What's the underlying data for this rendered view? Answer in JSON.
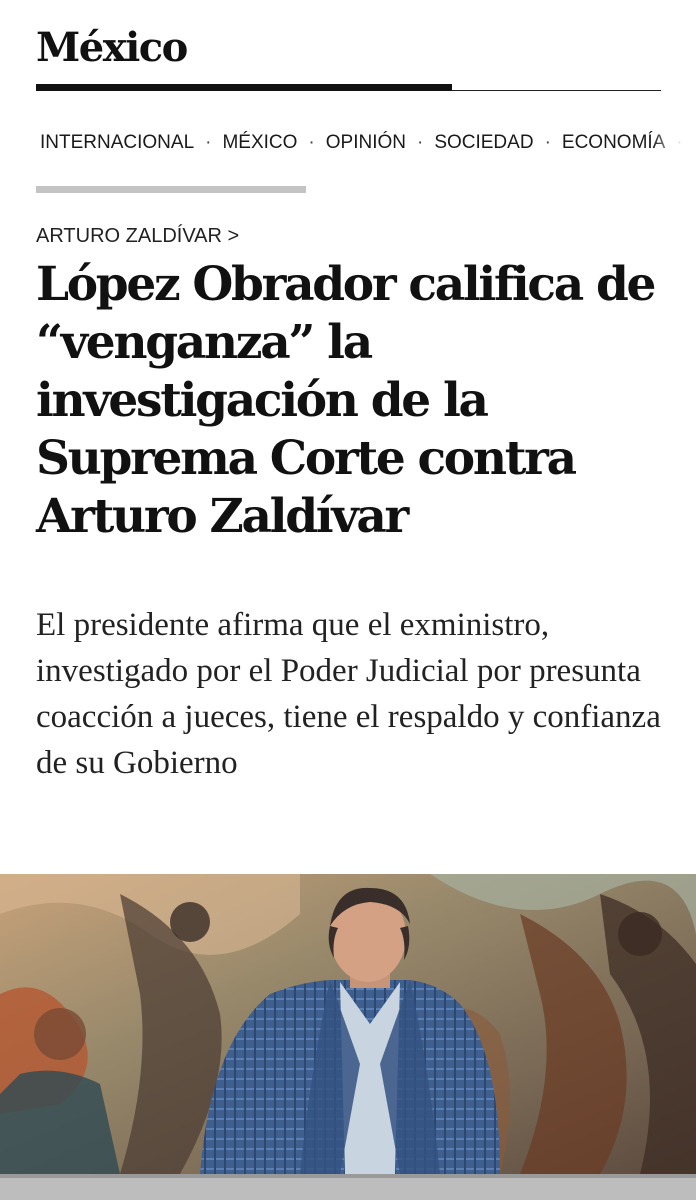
{
  "section": {
    "title": "México"
  },
  "nav": {
    "items": [
      {
        "label": "INTERNACIONAL"
      },
      {
        "label": "MÉXICO"
      },
      {
        "label": "OPINIÓN"
      },
      {
        "label": "SOCIEDAD"
      },
      {
        "label": "ECONOMÍA"
      }
    ],
    "separator": "·"
  },
  "article": {
    "kicker": "ARTURO ZALDÍVAR >",
    "headline": "López Obrador califica de “venganza” la investigación de la Suprema Corte contra Arturo Zaldívar",
    "subheadline": "El presidente afirma que el exministro, investigado por el Poder Judicial por presunta coacción a jueces, tiene el respaldo y confianza de su Gobierno"
  },
  "colors": {
    "text": "#111111",
    "rule": "#111111",
    "scroll_indicator": "#c4c4c4"
  }
}
